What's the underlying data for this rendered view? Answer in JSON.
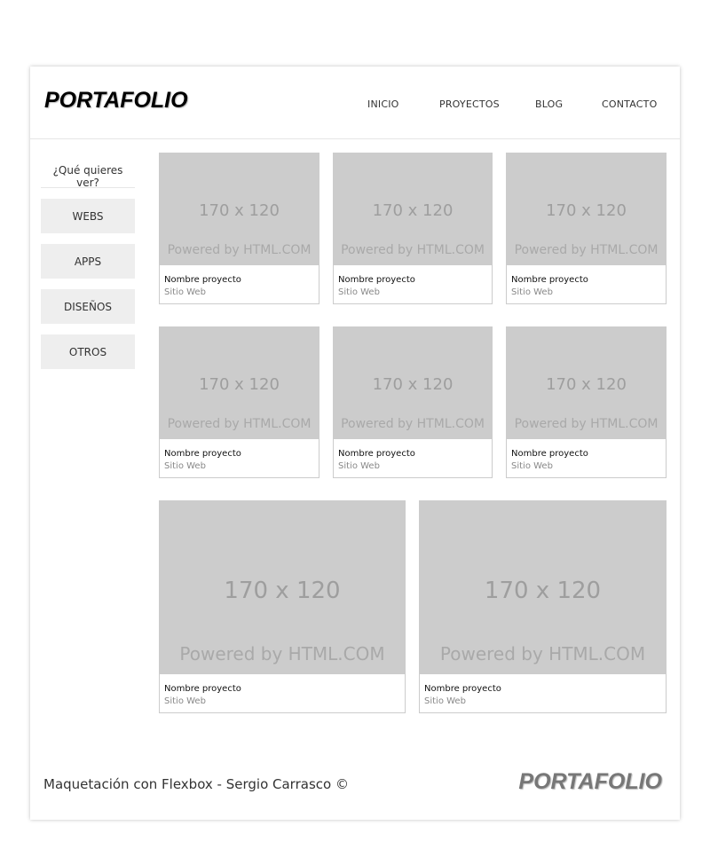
{
  "header": {
    "logo": "PORTAFOLIO",
    "nav": [
      "INICIO",
      "PROYECTOS",
      "BLOG",
      "CONTACTO"
    ]
  },
  "sidebar": {
    "title": "¿Qué quieres ver?",
    "buttons": [
      "WEBS",
      "APPS",
      "DISEÑOS",
      "OTROS"
    ]
  },
  "projects": [
    {
      "size_label": "170 x 120",
      "powered": "Powered by HTML.COM",
      "name": "Nombre proyecto",
      "type": "Sitio Web"
    },
    {
      "size_label": "170 x 120",
      "powered": "Powered by HTML.COM",
      "name": "Nombre proyecto",
      "type": "Sitio Web"
    },
    {
      "size_label": "170 x 120",
      "powered": "Powered by HTML.COM",
      "name": "Nombre proyecto",
      "type": "Sitio Web"
    },
    {
      "size_label": "170 x 120",
      "powered": "Powered by HTML.COM",
      "name": "Nombre proyecto",
      "type": "Sitio Web"
    },
    {
      "size_label": "170 x 120",
      "powered": "Powered by HTML.COM",
      "name": "Nombre proyecto",
      "type": "Sitio Web"
    },
    {
      "size_label": "170 x 120",
      "powered": "Powered by HTML.COM",
      "name": "Nombre proyecto",
      "type": "Sitio Web"
    },
    {
      "size_label": "170 x 120",
      "powered": "Powered by HTML.COM",
      "name": "Nombre proyecto",
      "type": "Sitio Web"
    },
    {
      "size_label": "170 x 120",
      "powered": "Powered by HTML.COM",
      "name": "Nombre proyecto",
      "type": "Sitio Web"
    }
  ],
  "footer": {
    "text": "Maquetación con Flexbox - Sergio Carrasco ©",
    "logo": "PORTAFOLIO"
  },
  "colors": {
    "placeholder": "#cccccc",
    "sidebar_button": "#eeeeee",
    "border": "#cccccc"
  }
}
